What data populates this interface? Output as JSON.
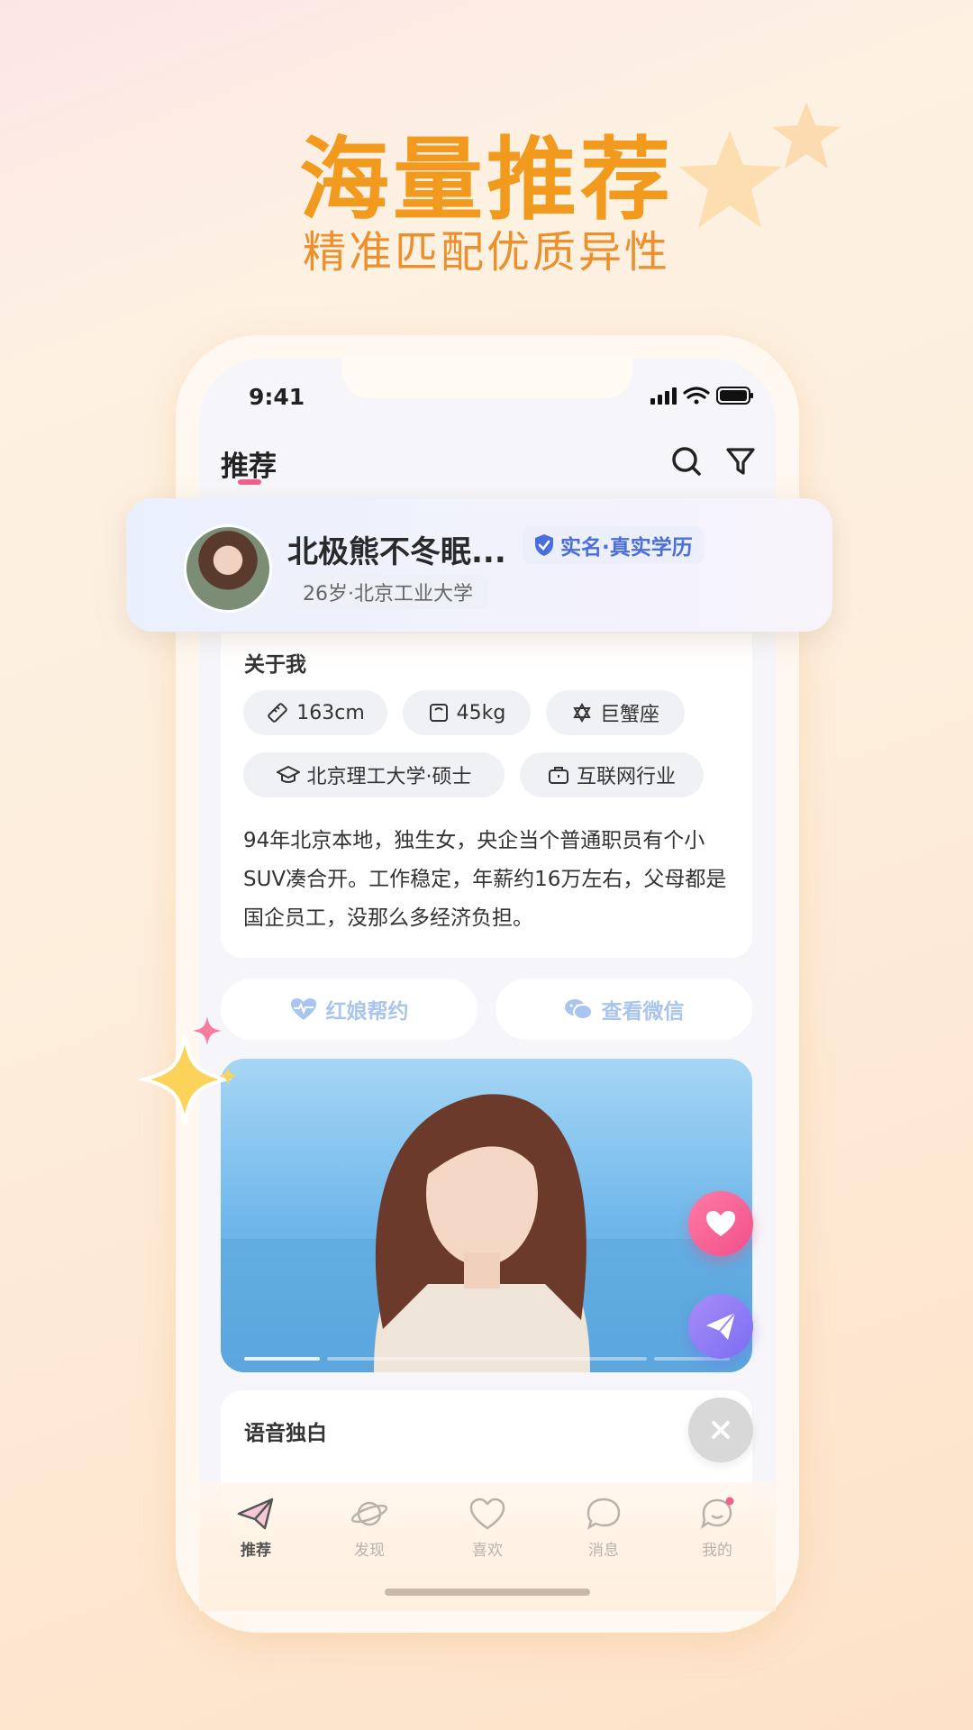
{
  "promo": {
    "title": "海量推荐",
    "subtitle": "精准匹配优质异性"
  },
  "status_bar": {
    "time": "9:41"
  },
  "header": {
    "tab": "推荐"
  },
  "profile": {
    "name": "北极熊不冬眠...",
    "verified_label": "实名·真实学历",
    "age_school": "26岁·北京工业大学"
  },
  "about": {
    "title": "关于我",
    "chips": [
      {
        "icon": "ruler-icon",
        "label": "163cm"
      },
      {
        "icon": "scale-icon",
        "label": "45kg"
      },
      {
        "icon": "star-of-david-icon",
        "label": "巨蟹座"
      },
      {
        "icon": "graduation-cap-icon",
        "label": "北京理工大学·硕士"
      },
      {
        "icon": "briefcase-icon",
        "label": "互联网行业"
      }
    ],
    "bio": "94年北京本地，独生女，央企当个普通职员有个小SUV凑合开。工作稳定，年薪约16万左右，父母都是国企员工，没那么多经济负担。"
  },
  "actions": {
    "matchmaker": "红娘帮约",
    "wechat": "查看微信"
  },
  "voice": {
    "title": "语音独白"
  },
  "nav": {
    "items": [
      {
        "label": "推荐",
        "icon": "paper-plane-icon",
        "active": true
      },
      {
        "label": "发现",
        "icon": "planet-icon",
        "active": false
      },
      {
        "label": "喜欢",
        "icon": "heart-icon",
        "active": false
      },
      {
        "label": "消息",
        "icon": "chat-bubble-icon",
        "active": false
      },
      {
        "label": "我的",
        "icon": "profile-icon",
        "active": false
      }
    ]
  },
  "colors": {
    "accent_orange": "#f29a1d",
    "pink": "#f0608c",
    "blue": "#4a6ee0",
    "purple": "#8f7af0"
  }
}
